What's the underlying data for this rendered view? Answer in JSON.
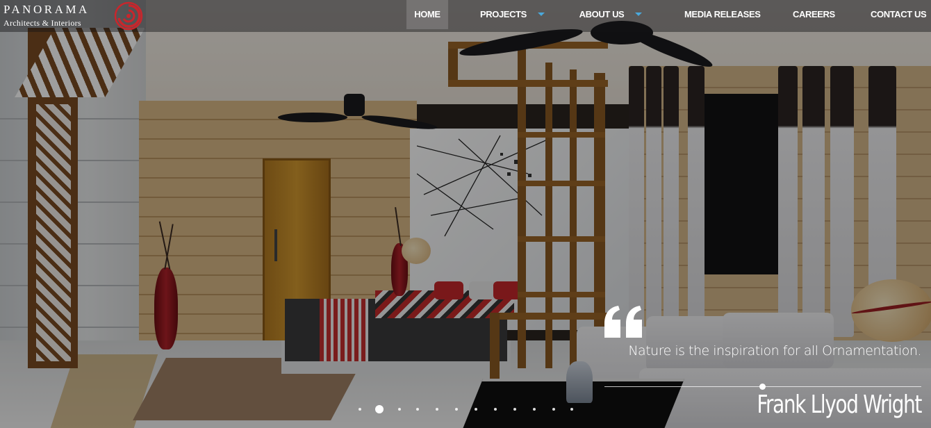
{
  "brand": {
    "name": "PANORAMA",
    "subtitle": "Architects & Interiors",
    "logo_icon": "spiral-logo-icon",
    "logo_color": "#c8262c"
  },
  "nav": {
    "items": [
      {
        "label": "HOME",
        "active": true,
        "has_dropdown": false
      },
      {
        "label": "PROJECTS",
        "active": false,
        "has_dropdown": true
      },
      {
        "label": "ABOUT US",
        "active": false,
        "has_dropdown": true
      },
      {
        "label": "MEDIA RELEASES",
        "active": false,
        "has_dropdown": false
      },
      {
        "label": "CAREERS",
        "active": false,
        "has_dropdown": false
      },
      {
        "label": "CONTACT US",
        "active": false,
        "has_dropdown": false
      }
    ],
    "caret_color": "#4aa9dc"
  },
  "hero": {
    "quote_icon": "quote-icon",
    "quote": "Nature is the inspiration for all Ornamentation.",
    "author": "Frank Llyod Wright"
  },
  "slider": {
    "total_slides": 12,
    "active_index": 1
  }
}
